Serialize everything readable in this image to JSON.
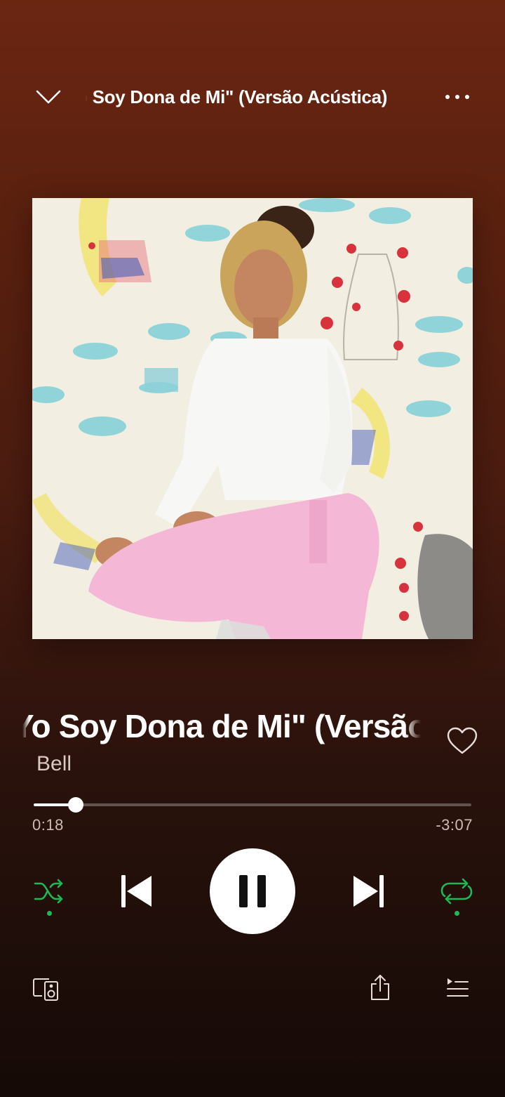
{
  "header": {
    "title": "Yo Soy Dona de Mi\" (Versão Acústica)"
  },
  "track": {
    "title": "Yo Soy Dona de Mi\" (Versão Acústica)",
    "artist": "Bell",
    "liked": false
  },
  "playback": {
    "elapsed": "0:18",
    "remaining": "-3:07",
    "progress_fraction": 0.0963,
    "state": "playing",
    "shuffle": true,
    "repeat": true
  },
  "icons": {
    "collapse": "chevron-down-icon",
    "more": "more-dots-icon",
    "like": "heart-outline-icon",
    "shuffle": "shuffle-icon",
    "previous": "skip-previous-icon",
    "pause": "pause-icon",
    "next": "skip-next-icon",
    "repeat": "repeat-icon",
    "devices": "connect-devices-icon",
    "share": "share-icon",
    "queue": "queue-icon"
  },
  "colors": {
    "accent": "#1db954",
    "background_top": "#6b2612",
    "background_bottom": "#150a07"
  }
}
